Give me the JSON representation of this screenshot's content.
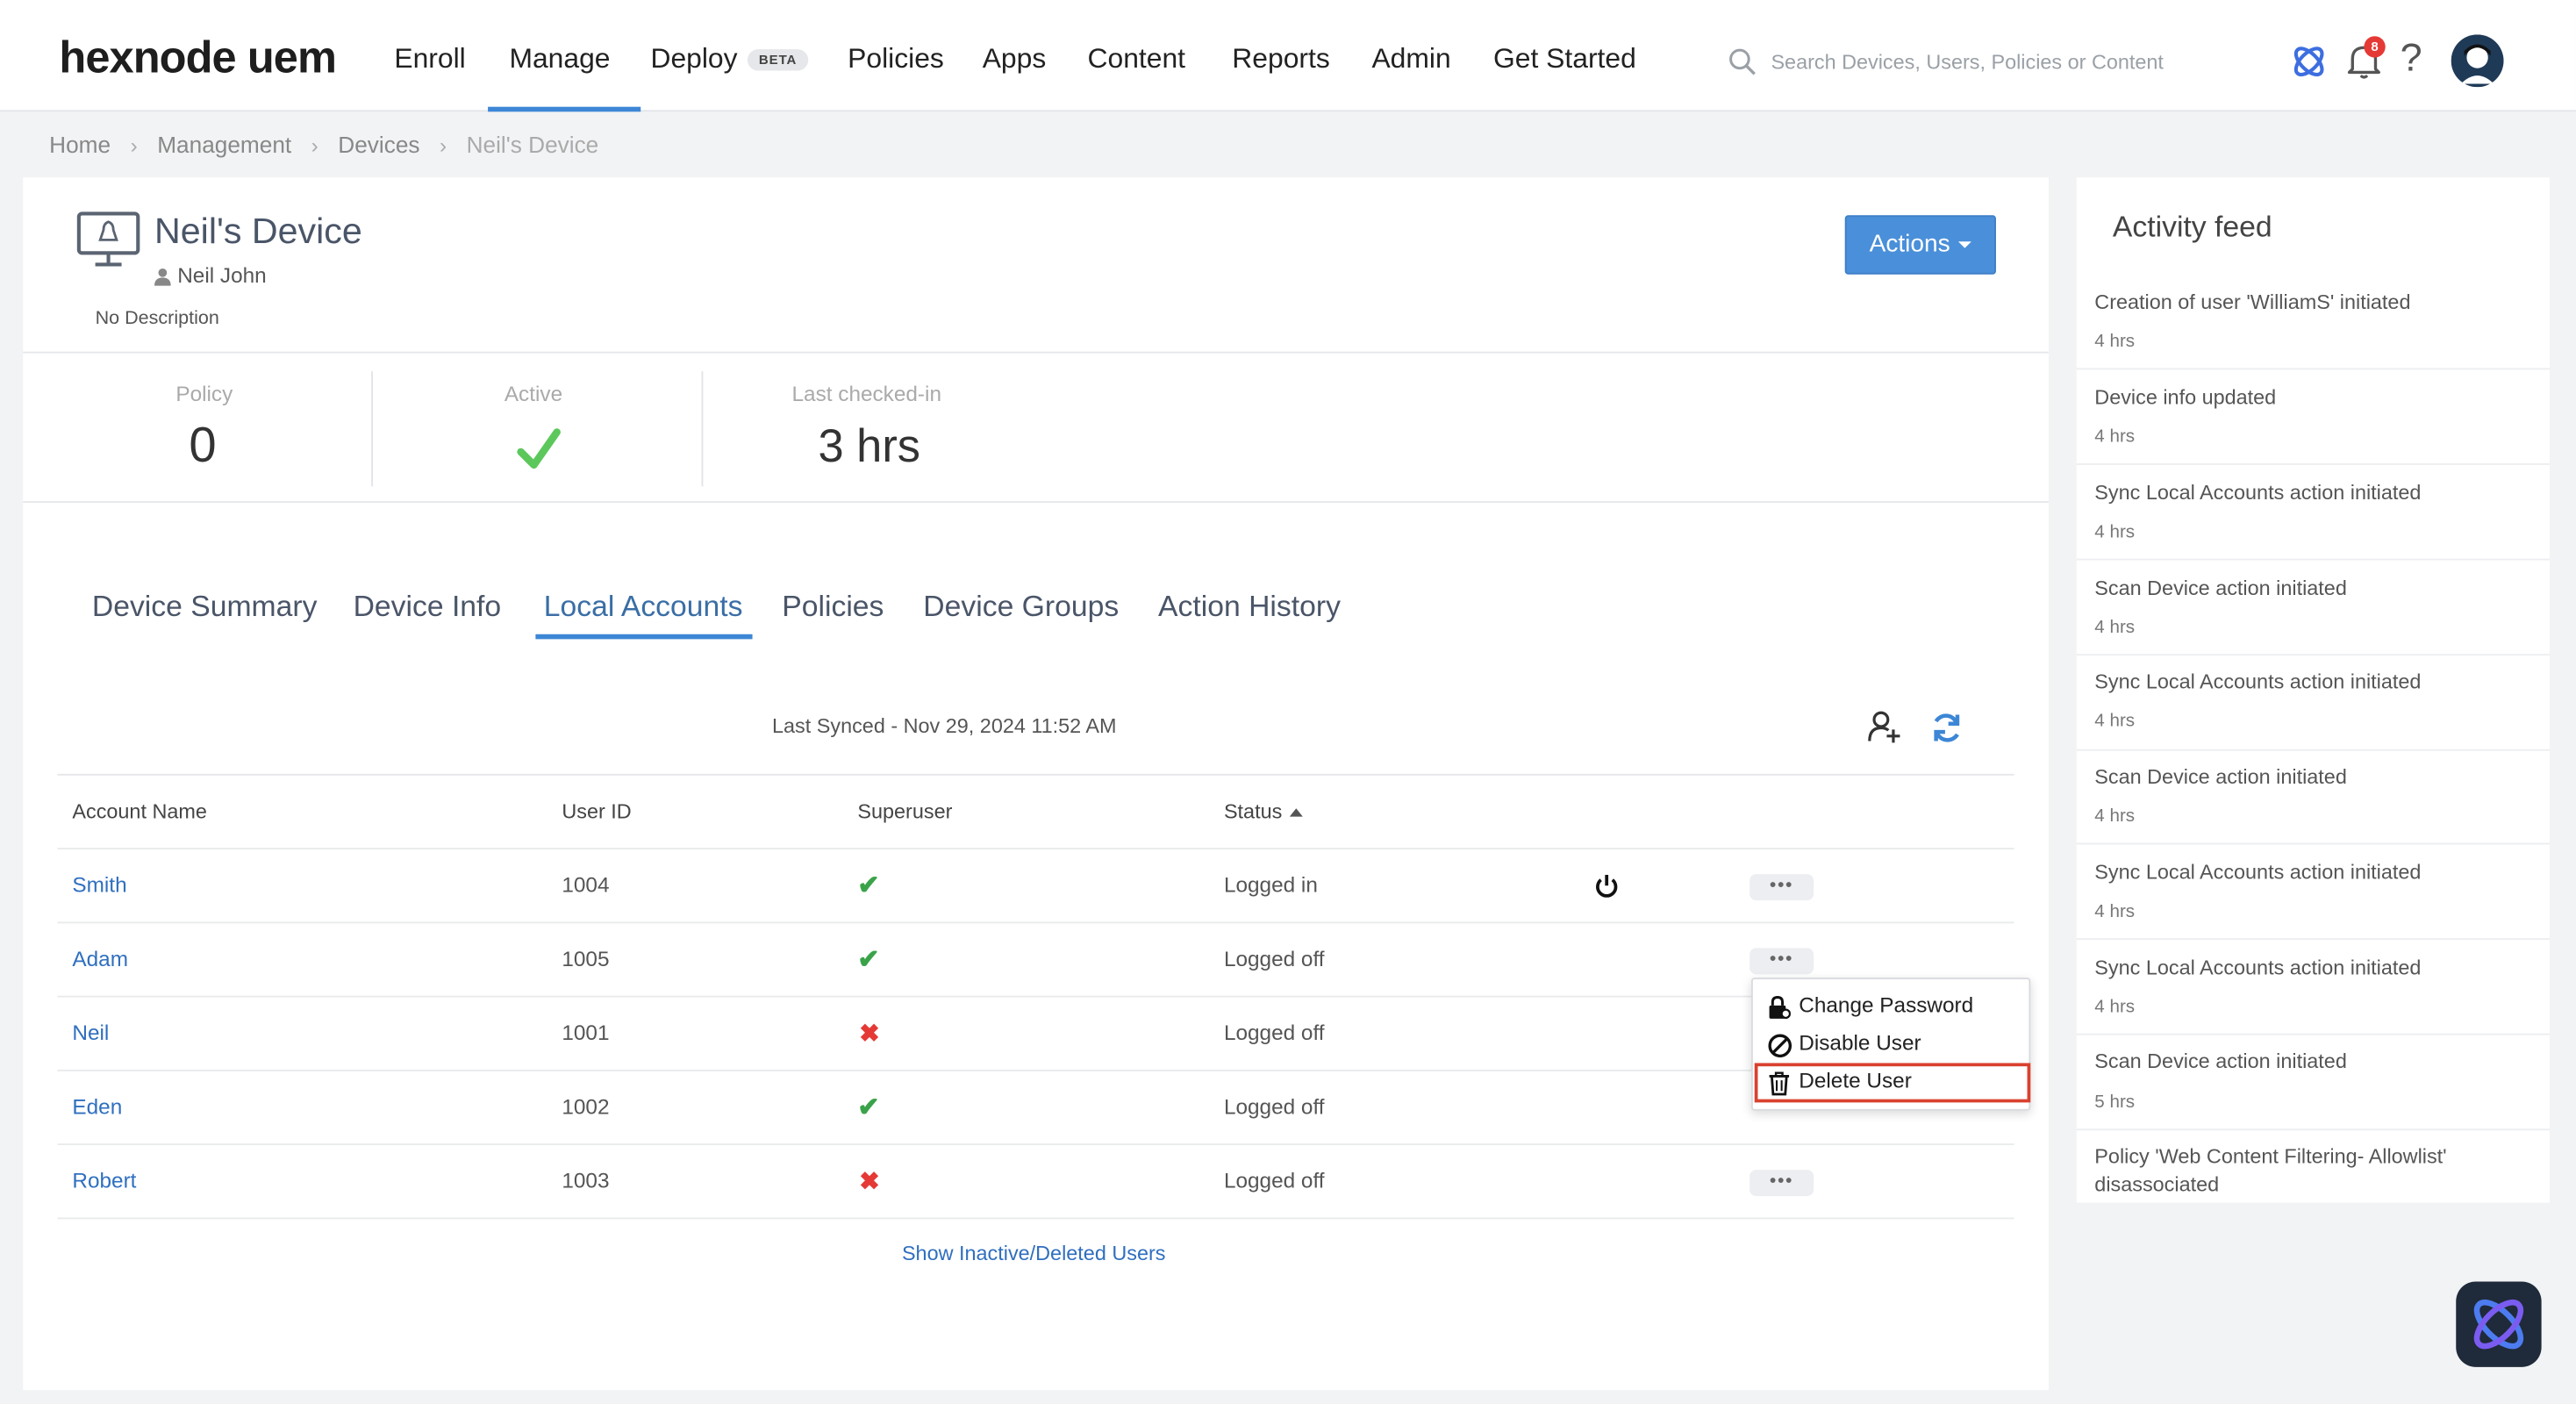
{
  "brand": {
    "logo": "hexnode uem"
  },
  "nav": {
    "items": [
      {
        "label": "Enroll"
      },
      {
        "label": "Manage"
      },
      {
        "label": "Deploy",
        "badge": "BETA"
      },
      {
        "label": "Policies"
      },
      {
        "label": "Apps"
      },
      {
        "label": "Content"
      },
      {
        "label": "Reports"
      },
      {
        "label": "Admin"
      },
      {
        "label": "Get Started"
      }
    ],
    "search_placeholder": "Search Devices, Users, Policies or Content",
    "notification_count": "8",
    "help_glyph": "?"
  },
  "breadcrumb": [
    "Home",
    "Management",
    "Devices",
    "Neil's Device"
  ],
  "device": {
    "title": "Neil's Device",
    "user": "Neil John",
    "description": "No Description",
    "actions_label": "Actions"
  },
  "stats": {
    "policy_label": "Policy",
    "policy_value": "0",
    "active_label": "Active",
    "last_label": "Last checked-in",
    "last_value": "3 hrs"
  },
  "tabs": [
    "Device Summary",
    "Device Info",
    "Local Accounts",
    "Policies",
    "Device Groups",
    "Action History"
  ],
  "local_accounts": {
    "last_synced": "Last Synced - Nov 29, 2024 11:52 AM",
    "columns": [
      "Account Name",
      "User ID",
      "Superuser",
      "Status"
    ],
    "rows": [
      {
        "name": "Smith",
        "id": "1004",
        "superuser": true,
        "status": "Logged in"
      },
      {
        "name": "Adam",
        "id": "1005",
        "superuser": true,
        "status": "Logged off"
      },
      {
        "name": "Neil",
        "id": "1001",
        "superuser": false,
        "status": "Logged off"
      },
      {
        "name": "Eden",
        "id": "1002",
        "superuser": true,
        "status": "Logged off"
      },
      {
        "name": "Robert",
        "id": "1003",
        "superuser": false,
        "status": "Logged off"
      }
    ],
    "more_glyph": "•••",
    "check_glyph": "✔",
    "cross_glyph": "✖",
    "show_inactive": "Show Inactive/Deleted Users"
  },
  "menu": {
    "items": [
      "Change Password",
      "Disable User",
      "Delete User"
    ]
  },
  "feed": {
    "title": "Activity feed",
    "items": [
      {
        "text": "Creation of user 'WilliamS' initiated",
        "time": "4 hrs"
      },
      {
        "text": "Device info updated",
        "time": "4 hrs"
      },
      {
        "text": "Sync Local Accounts action initiated",
        "time": "4 hrs"
      },
      {
        "text": "Scan Device action initiated",
        "time": "4 hrs"
      },
      {
        "text": "Sync Local Accounts action initiated",
        "time": "4 hrs"
      },
      {
        "text": "Scan Device action initiated",
        "time": "4 hrs"
      },
      {
        "text": "Sync Local Accounts action initiated",
        "time": "4 hrs"
      },
      {
        "text": "Sync Local Accounts action initiated",
        "time": "4 hrs"
      },
      {
        "text": "Scan Device action initiated",
        "time": "5 hrs"
      },
      {
        "text": "Policy 'Web Content Filtering- Allowlist' disassociated",
        "time": ""
      }
    ]
  },
  "colors": {
    "accent": "#3d86d6",
    "link": "#2f6fbf",
    "success": "#3aa34a",
    "danger": "#e53935"
  }
}
